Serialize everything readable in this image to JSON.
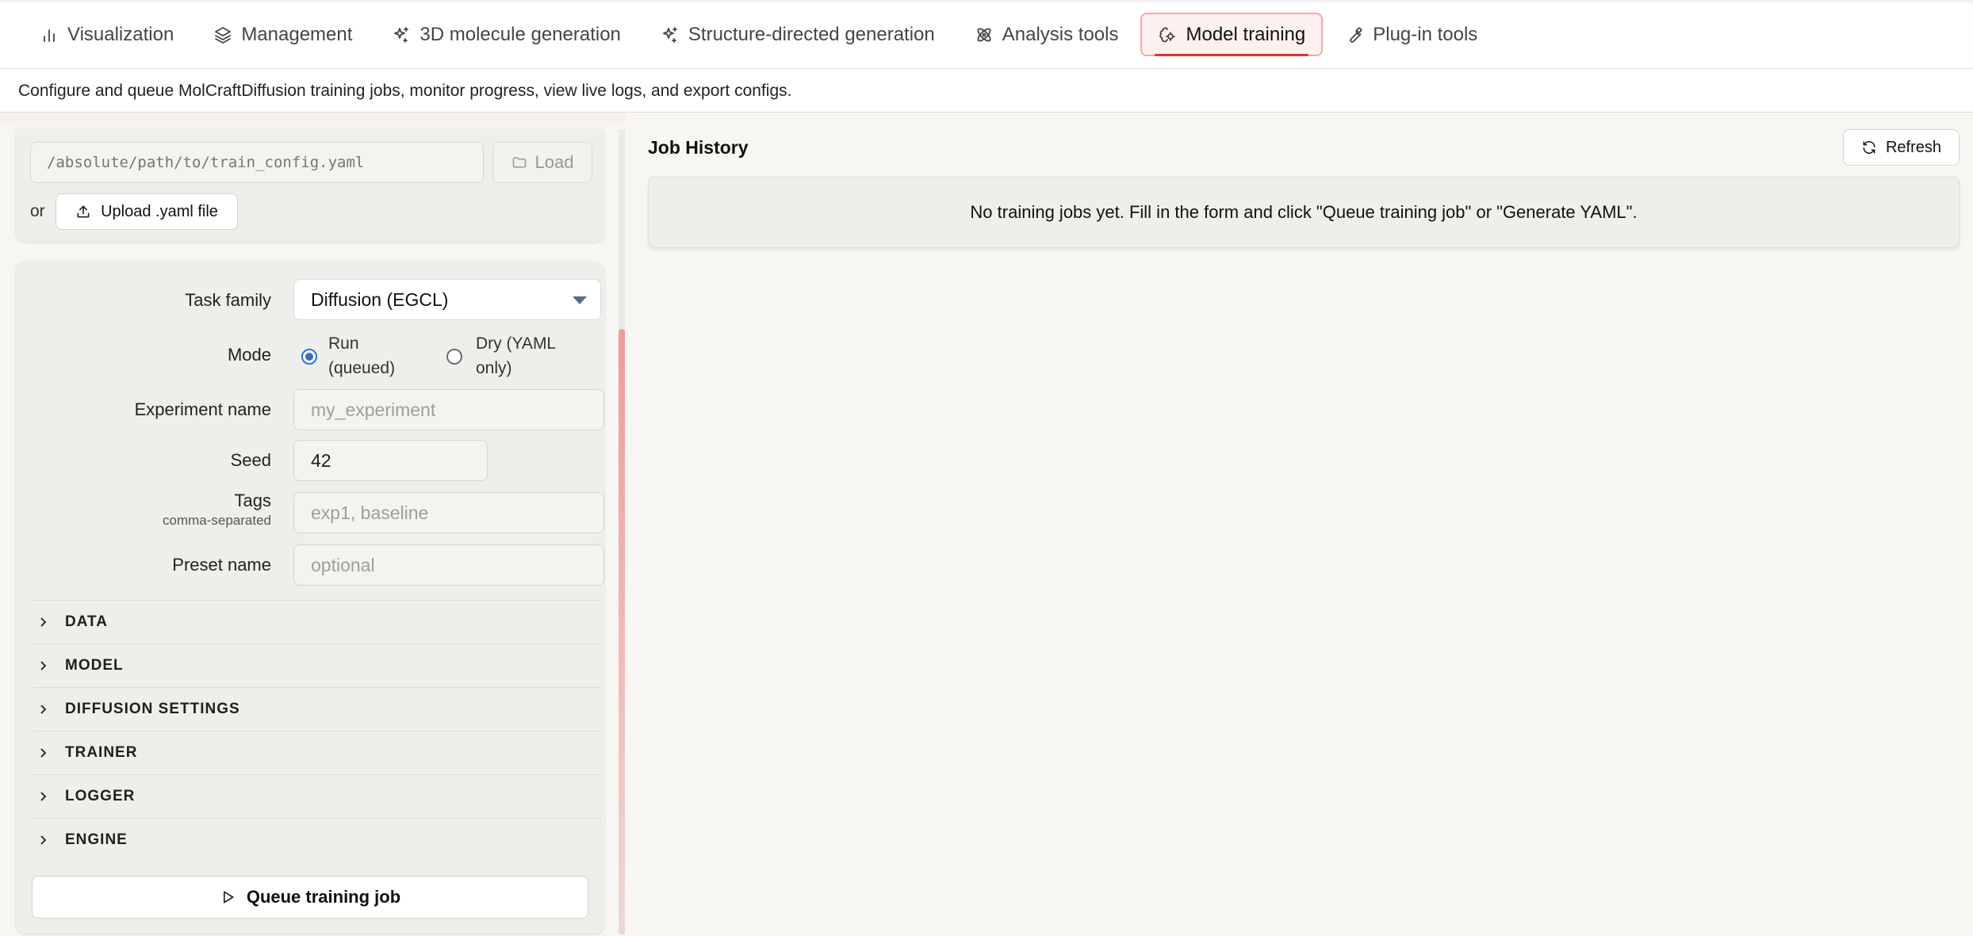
{
  "nav": {
    "tabs": [
      {
        "label": "Visualization",
        "icon": "bar-chart-icon"
      },
      {
        "label": "Management",
        "icon": "layers-icon"
      },
      {
        "label": "3D molecule generation",
        "icon": "sparkles-icon"
      },
      {
        "label": "Structure-directed generation",
        "icon": "sparkles-icon"
      },
      {
        "label": "Analysis tools",
        "icon": "atom-icon"
      },
      {
        "label": "Model training",
        "icon": "brain-cog-icon",
        "active": true
      },
      {
        "label": "Plug-in tools",
        "icon": "wrench-icon"
      }
    ]
  },
  "description": "Configure and queue MolCraftDiffusion training jobs, monitor progress, view live logs, and export configs.",
  "config_loader": {
    "path_placeholder": "/absolute/path/to/train_config.yaml",
    "load_label": "Load",
    "or_label": "or",
    "upload_label": "Upload .yaml file"
  },
  "form": {
    "task_family_label": "Task family",
    "task_family_value": "Diffusion (EGCL)",
    "mode_label": "Mode",
    "mode_run_line1": "Run",
    "mode_run_line2": "(queued)",
    "mode_dry_line1": "Dry (YAML",
    "mode_dry_line2": "only)",
    "mode_selected": "Run (queued)",
    "experiment_label": "Experiment name",
    "experiment_placeholder": "my_experiment",
    "seed_label": "Seed",
    "seed_value": "42",
    "tags_label": "Tags",
    "tags_sublabel": "comma-separated",
    "tags_placeholder": "exp1, baseline",
    "preset_label": "Preset name",
    "preset_placeholder": "optional"
  },
  "sections": [
    "DATA",
    "MODEL",
    "DIFFUSION SETTINGS",
    "TRAINER",
    "LOGGER",
    "ENGINE"
  ],
  "queue_button_label": "Queue training job",
  "job_history": {
    "title": "Job History",
    "refresh_label": "Refresh",
    "empty_message": "No training jobs yet. Fill in the form and click \"Queue training job\" or \"Generate YAML\"."
  },
  "colors": {
    "accent": "#e2362d",
    "radio": "#2f6fd6"
  }
}
